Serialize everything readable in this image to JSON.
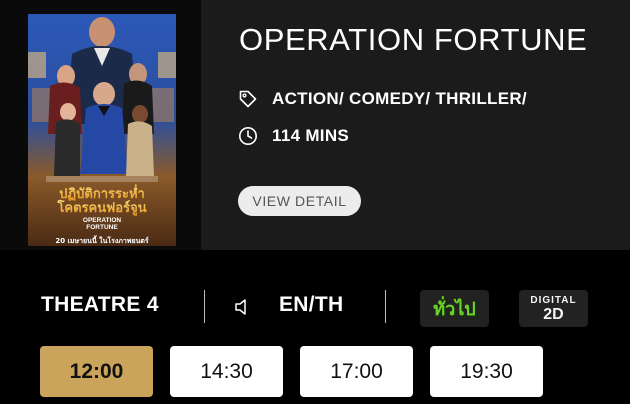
{
  "movie": {
    "title": "OPERATION FORTUNE",
    "genre": "ACTION/ COMEDY/ THRILLER/",
    "duration": "114 MINS",
    "detail_button": "VIEW DETAIL",
    "poster": {
      "thai_title_line1": "ปฏิบัติการระห่ำ",
      "thai_title_line2": "โคตรคนฟอร์จูน",
      "english_title_line1": "OPERATION",
      "english_title_line2": "FORTUNE",
      "release_text": "20 เมษายนนี้ ในโรงภาพยนตร์"
    }
  },
  "session": {
    "theatre": "THEATRE 4",
    "language": "EN/TH",
    "rating_badge": "ทั่วไป",
    "format_badge_top": "DIGITAL",
    "format_badge_bottom": "2D"
  },
  "showtimes": [
    "12:00",
    "14:30",
    "17:00",
    "19:30"
  ],
  "selected_showtime": "12:00",
  "colors": {
    "accent_gold": "#c9a45a",
    "rating_green": "#6fd22c",
    "card_bg": "#1b1b1b"
  },
  "icons": {
    "genre": "tag-icon",
    "duration": "clock-icon",
    "audio": "speaker-icon"
  }
}
